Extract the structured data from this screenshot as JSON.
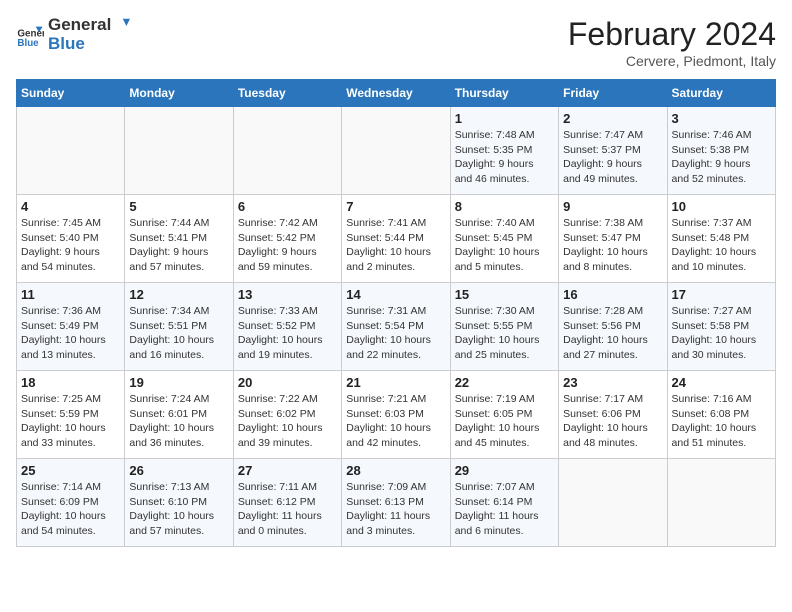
{
  "header": {
    "logo_general": "General",
    "logo_blue": "Blue",
    "month_title": "February 2024",
    "location": "Cervere, Piedmont, Italy"
  },
  "weekdays": [
    "Sunday",
    "Monday",
    "Tuesday",
    "Wednesday",
    "Thursday",
    "Friday",
    "Saturday"
  ],
  "weeks": [
    [
      {
        "day": "",
        "info": ""
      },
      {
        "day": "",
        "info": ""
      },
      {
        "day": "",
        "info": ""
      },
      {
        "day": "",
        "info": ""
      },
      {
        "day": "1",
        "info": "Sunrise: 7:48 AM\nSunset: 5:35 PM\nDaylight: 9 hours\nand 46 minutes."
      },
      {
        "day": "2",
        "info": "Sunrise: 7:47 AM\nSunset: 5:37 PM\nDaylight: 9 hours\nand 49 minutes."
      },
      {
        "day": "3",
        "info": "Sunrise: 7:46 AM\nSunset: 5:38 PM\nDaylight: 9 hours\nand 52 minutes."
      }
    ],
    [
      {
        "day": "4",
        "info": "Sunrise: 7:45 AM\nSunset: 5:40 PM\nDaylight: 9 hours\nand 54 minutes."
      },
      {
        "day": "5",
        "info": "Sunrise: 7:44 AM\nSunset: 5:41 PM\nDaylight: 9 hours\nand 57 minutes."
      },
      {
        "day": "6",
        "info": "Sunrise: 7:42 AM\nSunset: 5:42 PM\nDaylight: 9 hours\nand 59 minutes."
      },
      {
        "day": "7",
        "info": "Sunrise: 7:41 AM\nSunset: 5:44 PM\nDaylight: 10 hours\nand 2 minutes."
      },
      {
        "day": "8",
        "info": "Sunrise: 7:40 AM\nSunset: 5:45 PM\nDaylight: 10 hours\nand 5 minutes."
      },
      {
        "day": "9",
        "info": "Sunrise: 7:38 AM\nSunset: 5:47 PM\nDaylight: 10 hours\nand 8 minutes."
      },
      {
        "day": "10",
        "info": "Sunrise: 7:37 AM\nSunset: 5:48 PM\nDaylight: 10 hours\nand 10 minutes."
      }
    ],
    [
      {
        "day": "11",
        "info": "Sunrise: 7:36 AM\nSunset: 5:49 PM\nDaylight: 10 hours\nand 13 minutes."
      },
      {
        "day": "12",
        "info": "Sunrise: 7:34 AM\nSunset: 5:51 PM\nDaylight: 10 hours\nand 16 minutes."
      },
      {
        "day": "13",
        "info": "Sunrise: 7:33 AM\nSunset: 5:52 PM\nDaylight: 10 hours\nand 19 minutes."
      },
      {
        "day": "14",
        "info": "Sunrise: 7:31 AM\nSunset: 5:54 PM\nDaylight: 10 hours\nand 22 minutes."
      },
      {
        "day": "15",
        "info": "Sunrise: 7:30 AM\nSunset: 5:55 PM\nDaylight: 10 hours\nand 25 minutes."
      },
      {
        "day": "16",
        "info": "Sunrise: 7:28 AM\nSunset: 5:56 PM\nDaylight: 10 hours\nand 27 minutes."
      },
      {
        "day": "17",
        "info": "Sunrise: 7:27 AM\nSunset: 5:58 PM\nDaylight: 10 hours\nand 30 minutes."
      }
    ],
    [
      {
        "day": "18",
        "info": "Sunrise: 7:25 AM\nSunset: 5:59 PM\nDaylight: 10 hours\nand 33 minutes."
      },
      {
        "day": "19",
        "info": "Sunrise: 7:24 AM\nSunset: 6:01 PM\nDaylight: 10 hours\nand 36 minutes."
      },
      {
        "day": "20",
        "info": "Sunrise: 7:22 AM\nSunset: 6:02 PM\nDaylight: 10 hours\nand 39 minutes."
      },
      {
        "day": "21",
        "info": "Sunrise: 7:21 AM\nSunset: 6:03 PM\nDaylight: 10 hours\nand 42 minutes."
      },
      {
        "day": "22",
        "info": "Sunrise: 7:19 AM\nSunset: 6:05 PM\nDaylight: 10 hours\nand 45 minutes."
      },
      {
        "day": "23",
        "info": "Sunrise: 7:17 AM\nSunset: 6:06 PM\nDaylight: 10 hours\nand 48 minutes."
      },
      {
        "day": "24",
        "info": "Sunrise: 7:16 AM\nSunset: 6:08 PM\nDaylight: 10 hours\nand 51 minutes."
      }
    ],
    [
      {
        "day": "25",
        "info": "Sunrise: 7:14 AM\nSunset: 6:09 PM\nDaylight: 10 hours\nand 54 minutes."
      },
      {
        "day": "26",
        "info": "Sunrise: 7:13 AM\nSunset: 6:10 PM\nDaylight: 10 hours\nand 57 minutes."
      },
      {
        "day": "27",
        "info": "Sunrise: 7:11 AM\nSunset: 6:12 PM\nDaylight: 11 hours\nand 0 minutes."
      },
      {
        "day": "28",
        "info": "Sunrise: 7:09 AM\nSunset: 6:13 PM\nDaylight: 11 hours\nand 3 minutes."
      },
      {
        "day": "29",
        "info": "Sunrise: 7:07 AM\nSunset: 6:14 PM\nDaylight: 11 hours\nand 6 minutes."
      },
      {
        "day": "",
        "info": ""
      },
      {
        "day": "",
        "info": ""
      }
    ]
  ]
}
